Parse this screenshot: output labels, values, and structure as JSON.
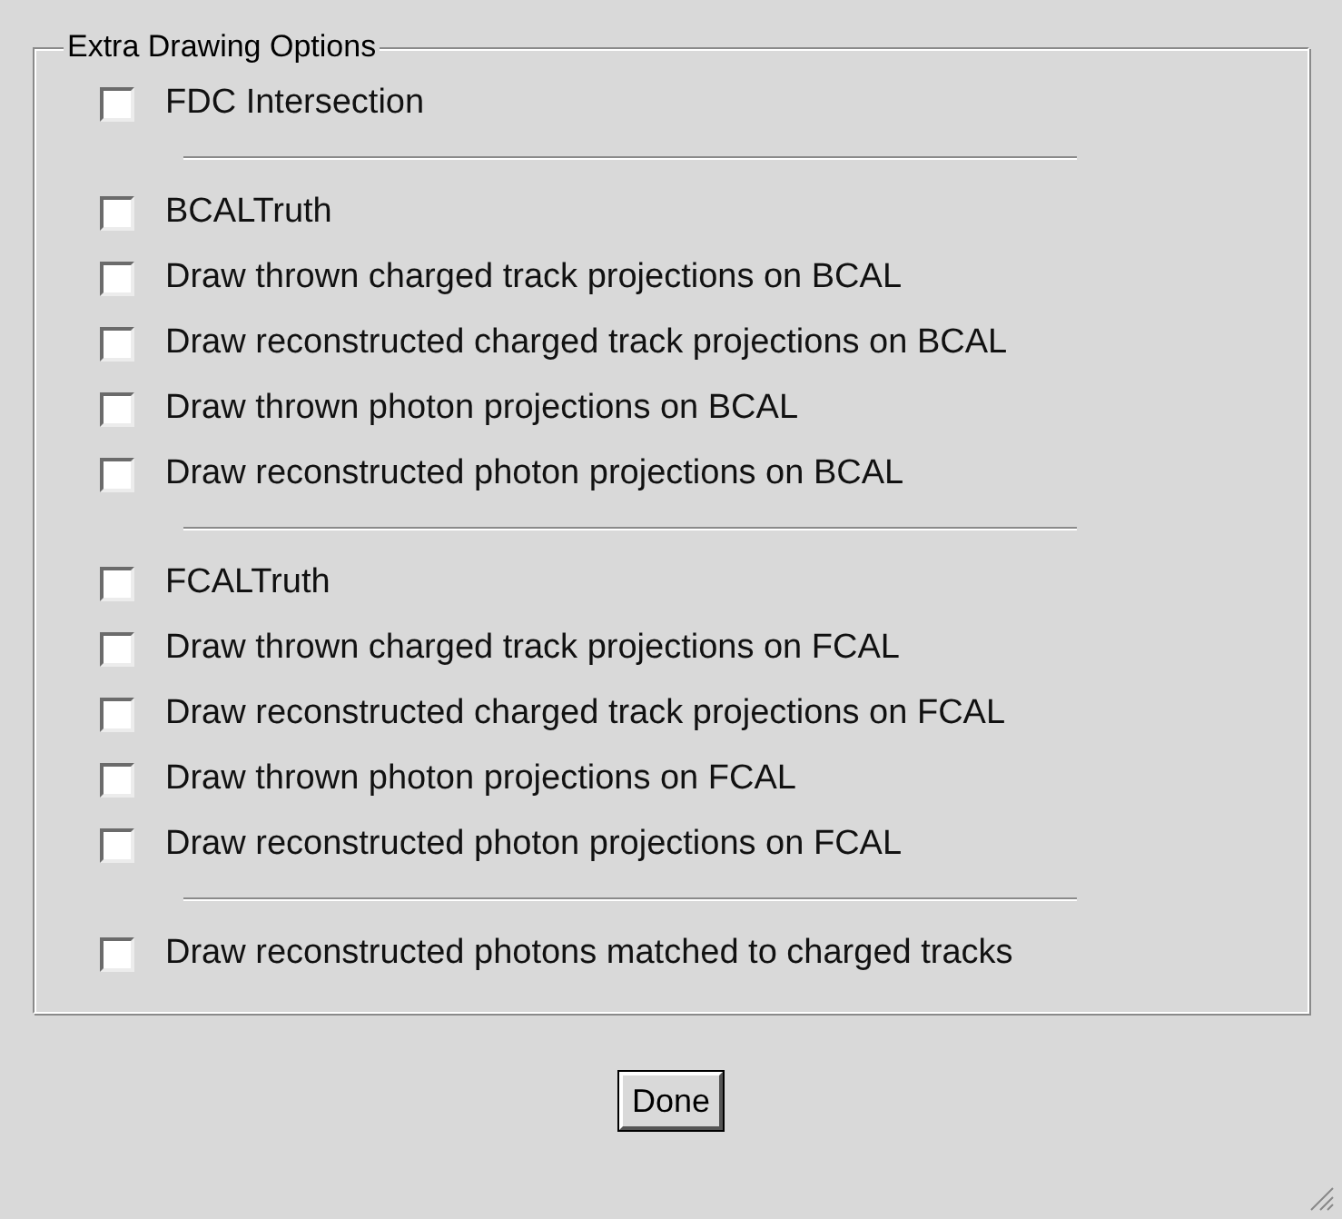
{
  "group": {
    "title": "Extra Drawing Options",
    "sections": [
      {
        "items": [
          {
            "label": "FDC Intersection",
            "checked": false
          }
        ]
      },
      {
        "items": [
          {
            "label": "BCALTruth",
            "checked": false
          },
          {
            "label": "Draw thrown charged track projections on BCAL",
            "checked": false
          },
          {
            "label": "Draw reconstructed charged track projections on BCAL",
            "checked": false
          },
          {
            "label": "Draw thrown photon projections on BCAL",
            "checked": false
          },
          {
            "label": "Draw reconstructed photon projections on BCAL",
            "checked": false
          }
        ]
      },
      {
        "items": [
          {
            "label": "FCALTruth",
            "checked": false
          },
          {
            "label": "Draw thrown charged track projections on FCAL",
            "checked": false
          },
          {
            "label": "Draw reconstructed charged track projections on FCAL",
            "checked": false
          },
          {
            "label": "Draw thrown photon projections on FCAL",
            "checked": false
          },
          {
            "label": "Draw reconstructed photon projections on FCAL",
            "checked": false
          }
        ]
      },
      {
        "items": [
          {
            "label": "Draw reconstructed photons matched to charged tracks",
            "checked": false
          }
        ]
      }
    ]
  },
  "button": "Done"
}
